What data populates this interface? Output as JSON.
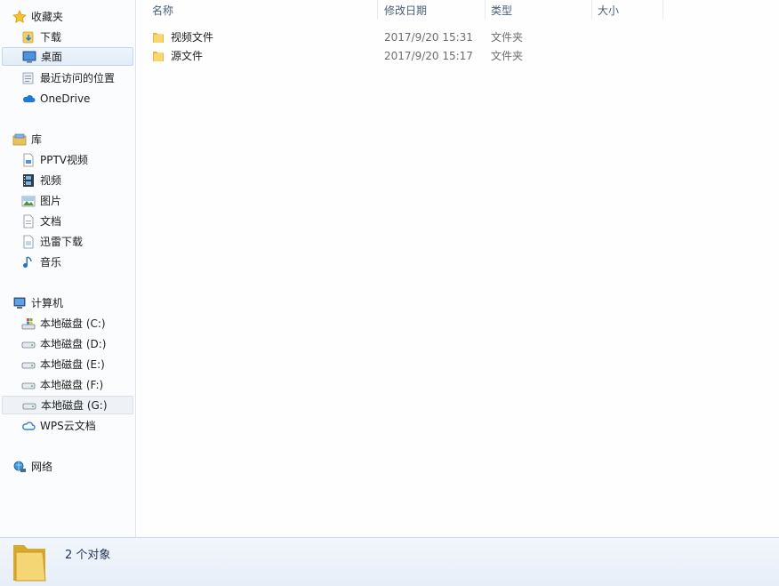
{
  "nav": {
    "favorites": {
      "label": "收藏夹",
      "items": [
        {
          "label": "下载",
          "icon": "download-folder-icon"
        },
        {
          "label": "桌面",
          "icon": "desktop-icon"
        },
        {
          "label": "最近访问的位置",
          "icon": "recent-places-icon"
        },
        {
          "label": "OneDrive",
          "icon": "onedrive-cloud-icon"
        }
      ]
    },
    "libraries": {
      "label": "库",
      "items": [
        {
          "label": "PPTV视频",
          "icon": "document-icon"
        },
        {
          "label": "视频",
          "icon": "video-icon"
        },
        {
          "label": "图片",
          "icon": "picture-icon"
        },
        {
          "label": "文档",
          "icon": "document-icon"
        },
        {
          "label": "迅雷下载",
          "icon": "document-icon"
        },
        {
          "label": "音乐",
          "icon": "music-icon"
        }
      ]
    },
    "computer": {
      "label": "计算机",
      "items": [
        {
          "label": "本地磁盘 (C:)",
          "icon": "system-drive-icon"
        },
        {
          "label": "本地磁盘 (D:)",
          "icon": "drive-icon"
        },
        {
          "label": "本地磁盘 (E:)",
          "icon": "drive-icon"
        },
        {
          "label": "本地磁盘 (F:)",
          "icon": "drive-icon"
        },
        {
          "label": "本地磁盘 (G:)",
          "icon": "drive-icon"
        },
        {
          "label": "WPS云文档",
          "icon": "wps-cloud-icon"
        }
      ]
    },
    "network": {
      "label": "网络"
    }
  },
  "columns": {
    "name": "名称",
    "modified": "修改日期",
    "type": "类型",
    "size": "大小"
  },
  "files": [
    {
      "name": "视频文件",
      "modified": "2017/9/20 15:31",
      "type": "文件夹",
      "size": ""
    },
    {
      "name": "源文件",
      "modified": "2017/9/20 15:17",
      "type": "文件夹",
      "size": ""
    }
  ],
  "status": {
    "text": "2 个对象"
  },
  "colors": {
    "selection": "#e2ecf8",
    "status_bg": "#e9f0f9",
    "folder": "#f2c84b"
  }
}
